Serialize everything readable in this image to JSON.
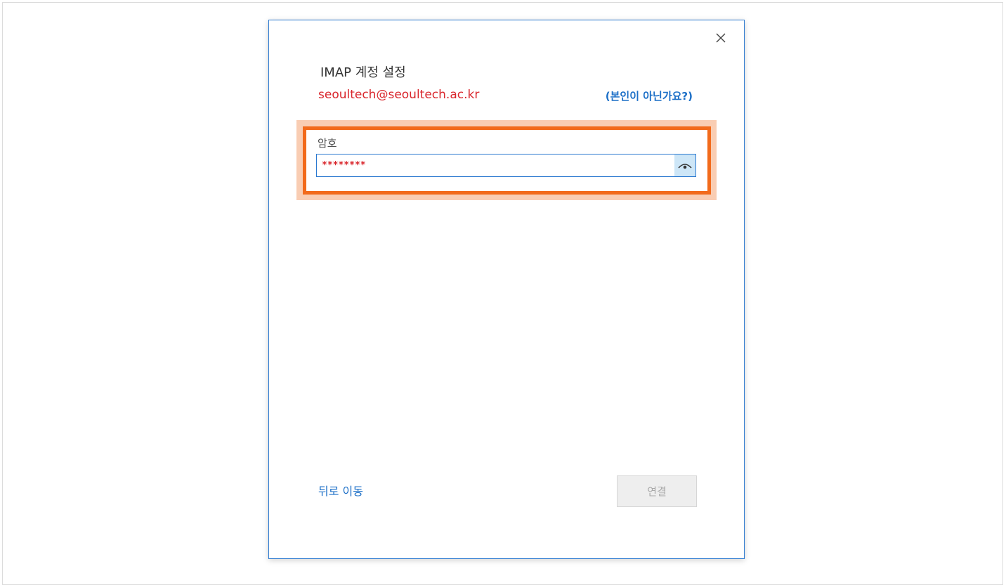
{
  "dialog": {
    "title": "IMAP 계정 설정",
    "email": "seoultech@seoultech.ac.kr",
    "not_you_link": "(본인이 아닌가요?)",
    "close_icon": "close-icon"
  },
  "password": {
    "label": "암호",
    "value": "********",
    "reveal_icon": "eye-icon"
  },
  "footer": {
    "back_link": "뒤로 이동",
    "connect_button": "연결",
    "connect_enabled": false
  },
  "colors": {
    "accent": "#1c6fc7",
    "annotation_red": "#d9262c",
    "highlight_orange": "#f26a1b",
    "dialog_border": "#2b79d0"
  }
}
